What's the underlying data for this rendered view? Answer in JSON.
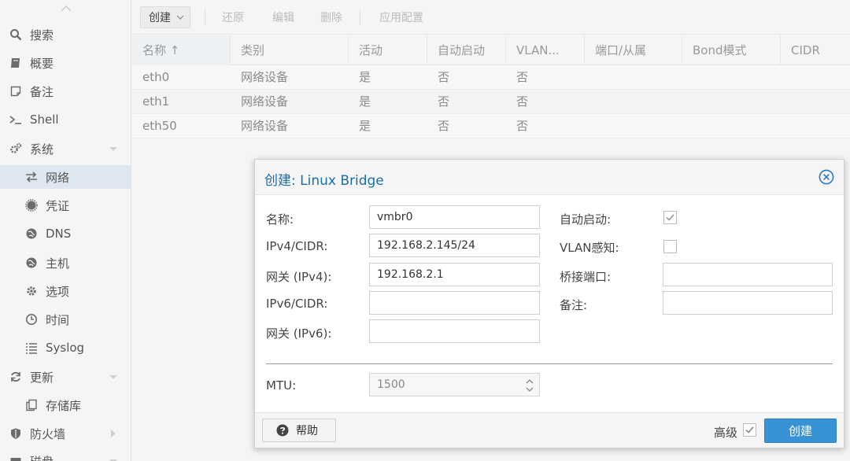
{
  "sidebar": {
    "items": [
      {
        "label": "搜索",
        "icon": "search-icon"
      },
      {
        "label": "概要",
        "icon": "book-icon"
      },
      {
        "label": "备注",
        "icon": "note-icon"
      },
      {
        "label": "Shell",
        "icon": "terminal-icon"
      },
      {
        "label": "系统",
        "icon": "cogs-icon"
      },
      {
        "label": "网络",
        "icon": "exchange-icon"
      },
      {
        "label": "凭证",
        "icon": "certificate-icon"
      },
      {
        "label": "DNS",
        "icon": "globe-icon"
      },
      {
        "label": "主机",
        "icon": "globe-icon"
      },
      {
        "label": "选项",
        "icon": "gear-icon"
      },
      {
        "label": "时间",
        "icon": "clock-icon"
      },
      {
        "label": "Syslog",
        "icon": "list-icon"
      },
      {
        "label": "更新",
        "icon": "refresh-icon"
      },
      {
        "label": "存储库",
        "icon": "files-icon"
      },
      {
        "label": "防火墙",
        "icon": "shield-icon"
      },
      {
        "label": "磁盘",
        "icon": "disk-icon"
      }
    ],
    "active": "网络"
  },
  "toolbar": {
    "create_label": "创建",
    "revert_label": "还原",
    "edit_label": "编辑",
    "delete_label": "删除",
    "apply_label": "应用配置"
  },
  "grid": {
    "columns": [
      "名称 ↑",
      "类别",
      "活动",
      "自动启动",
      "VLAN...",
      "端口/从属",
      "Bond模式",
      "CIDR"
    ],
    "rows": [
      [
        "eth0",
        "网络设备",
        "是",
        "否",
        "否"
      ],
      [
        "eth1",
        "网络设备",
        "是",
        "否",
        "否"
      ],
      [
        "eth50",
        "网络设备",
        "是",
        "否",
        "否"
      ]
    ]
  },
  "dialog": {
    "title": "创建: Linux Bridge",
    "name_label": "名称:",
    "name_value": "vmbr0",
    "ipv4_label": "IPv4/CIDR:",
    "ipv4_value": "192.168.2.145/24",
    "gw4_label": "网关 (IPv4):",
    "gw4_value": "192.168.2.1",
    "ipv6_label": "IPv6/CIDR:",
    "ipv6_value": "",
    "gw6_label": "网关 (IPv6):",
    "gw6_value": "",
    "autostart_label": "自动启动:",
    "autostart_checked": true,
    "vlan_label": "VLAN感知:",
    "vlan_checked": false,
    "ports_label": "桥接端口:",
    "ports_value": "",
    "comment_label": "备注:",
    "comment_value": "",
    "mtu_label": "MTU:",
    "mtu_placeholder": "1500",
    "help_label": "帮助",
    "advanced_label": "高级",
    "advanced_checked": true,
    "create_label": "创建"
  },
  "colors": {
    "accent": "#3892d4",
    "title": "#1a6ea8",
    "active_nav": "#dee7ef"
  }
}
